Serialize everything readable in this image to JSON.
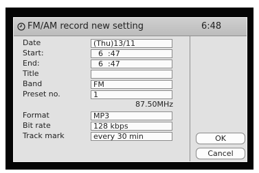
{
  "window": {
    "title": "FM/AM record new setting",
    "time": "6:48"
  },
  "form": {
    "rows": [
      {
        "label": "Date",
        "value": "(Thu)13/11"
      },
      {
        "label": "Start:",
        "value": "  6  :47"
      },
      {
        "label": "End:",
        "value": "  6  :47"
      },
      {
        "label": "Title",
        "value": ""
      },
      {
        "label": "Band",
        "value": "FM"
      },
      {
        "label": "Preset no.",
        "value": "1"
      },
      {
        "label": "Format",
        "value": "MP3"
      },
      {
        "label": "Bit rate",
        "value": "128 kbps"
      },
      {
        "label": "Track mark",
        "value": "every 30 min"
      }
    ],
    "frequency": "87.50MHz"
  },
  "buttons": {
    "ok": "OK",
    "cancel": "Cancel"
  },
  "icons": {
    "title_icon": "clock-icon"
  }
}
